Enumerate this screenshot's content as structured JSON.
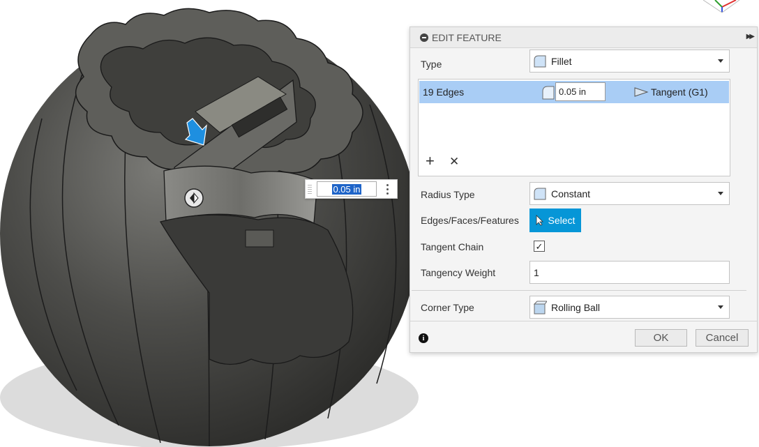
{
  "viewport": {
    "dimension_input_value": "0.05 in",
    "edge_arrow_icon": "blue-arrow-icon",
    "flip_icon": "flip-direction-icon"
  },
  "panel": {
    "title": "EDIT FEATURE",
    "expand_icon": "double-chevron-right-icon",
    "type": {
      "label": "Type",
      "value": "Fillet"
    },
    "edges": {
      "row_label": "19 Edges",
      "radius": "0.05 in",
      "continuity": "Tangent (G1)"
    },
    "radius_type": {
      "label": "Radius Type",
      "value": "Constant"
    },
    "selection": {
      "label": "Edges/Faces/Features",
      "button": "Select"
    },
    "tangent_chain": {
      "label": "Tangent Chain",
      "checked": true
    },
    "tangency_weight": {
      "label": "Tangency Weight",
      "value": "1"
    },
    "corner_type": {
      "label": "Corner Type",
      "value": "Rolling Ball"
    },
    "footer": {
      "ok": "OK",
      "cancel": "Cancel"
    }
  },
  "colors": {
    "accent": "#0696d7",
    "selected_row": "#a9cdf5",
    "model": "#4a4a4a"
  }
}
